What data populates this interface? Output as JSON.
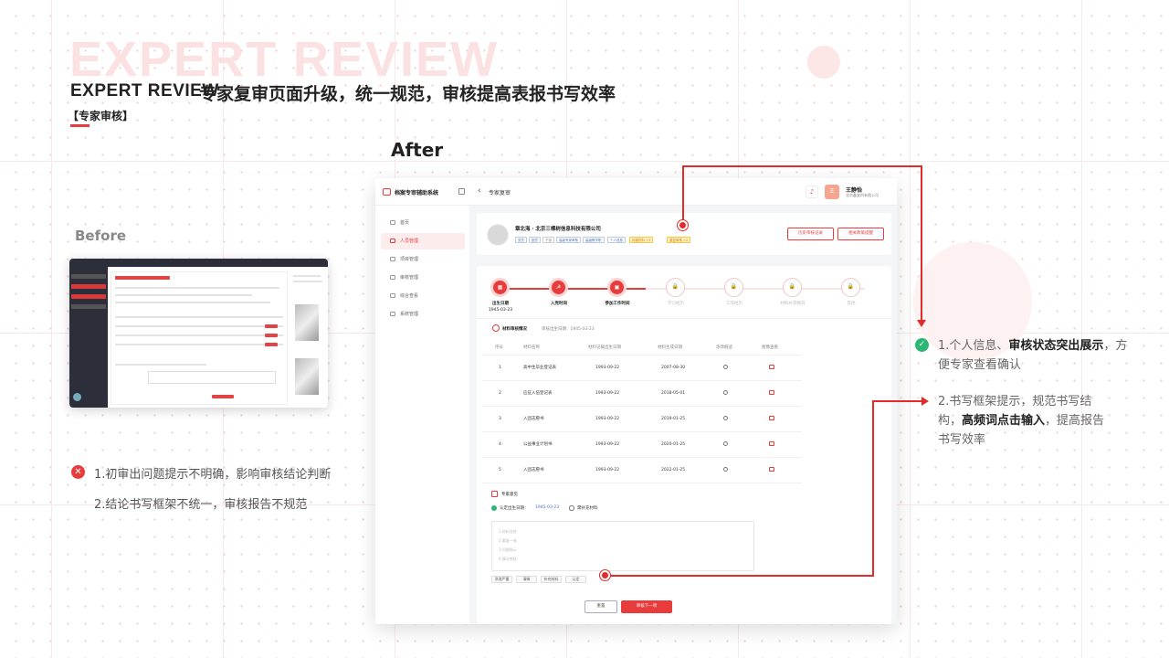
{
  "header": {
    "watermark": "EXPERT REVIEW",
    "title_en": "EXPERT REVIEW",
    "title_cn": "专家复审页面升级，统一规范，审核提高表报书写效率",
    "subtitle": "【专家审核】"
  },
  "labels": {
    "after": "After",
    "before": "Before"
  },
  "issues": [
    {
      "icon": "✕",
      "text": "1.初审出问题提示不明确，影响审核结论判断"
    },
    {
      "text": "2.结论书写框架不统一，审核报告不规范"
    }
  ],
  "improvements": {
    "icon": "✓",
    "n1_a": "1.个人信息、",
    "n1_b": "审核状态突出展示",
    "n1_c": "，方便专家查看确认",
    "n2_a": "2.书写框架提示，规范书写结构，",
    "n2_b": "高频词点击输入",
    "n2_c": "，提高报告书写效率"
  },
  "app": {
    "title": "档案专审辅助系统",
    "page": "专家复审",
    "user": {
      "initial": "王",
      "name": "王静怡",
      "org": "北京鑫宜科有限公司"
    },
    "nav": [
      "首页",
      "人员管理",
      "项目管理",
      "审核管理",
      "综合查看",
      "系统管理"
    ],
    "profile": {
      "name": "章北海 · 北京三棵树信息科技有限公司",
      "tags": [
        "党员",
        "团员",
        "干部",
        "高级专家审核",
        "高级教学职",
        "个人信息"
      ],
      "gold_tags": [
        "存疑材料 +3",
        "重复审核 +2"
      ],
      "btn_history": "历史审核记录",
      "btn_reminder": "相关政策提醒"
    },
    "steps": [
      {
        "label": "出生日期",
        "date": "1945-03-23",
        "icon": "▦"
      },
      {
        "label": "入党时间",
        "date": "",
        "icon": "☭"
      },
      {
        "label": "参加工作时间",
        "date": "",
        "icon": "▣"
      },
      {
        "label": "学习经历",
        "date": "",
        "icon": "🔒"
      },
      {
        "label": "工作经历",
        "date": "",
        "icon": "🔒"
      },
      {
        "label": "材料补充情况",
        "date": "",
        "icon": "🔒"
      },
      {
        "label": "其他",
        "date": "",
        "icon": "🔒"
      }
    ],
    "materials": {
      "title": "材料审核情况",
      "sub": "审核出生日期：1945-03-23",
      "headers": [
        "序号",
        "材料名称",
        "材料记载出生日期",
        "材料生成日期",
        "涂改痕迹",
        "图像查看"
      ],
      "rows": [
        [
          "1",
          "高中生毕业登记表",
          "1993-09-22",
          "2007-08-30"
        ],
        [
          "2",
          "应征入伍登记表",
          "1993-09-22",
          "2018-05-01"
        ],
        [
          "3",
          "入团志愿书",
          "1993-09-22",
          "2019-01-25"
        ],
        [
          "4",
          "公益事业计划书",
          "1993-09-22",
          "2020-01-25"
        ],
        [
          "5",
          "入团志愿书",
          "1993-09-22",
          "2022-01-25"
        ]
      ]
    },
    "opinion": {
      "title": "专家意见",
      "confirm_label": "认定出生日期：",
      "confirm_value": "1945-03-23",
      "alt": "需补充材料",
      "hints": [
        "1.材料名称",
        "2.重复一致",
        "3.问题指示",
        "4.情况审核"
      ],
      "chips": [
        "涂改严重",
        "清晰",
        "补充材料",
        "认定"
      ]
    },
    "btn_reset": "重置",
    "btn_next": "审核下一项"
  },
  "colors": {
    "accent": "#e83c3c",
    "success": "#2bb673",
    "link": "#4a70c0"
  }
}
